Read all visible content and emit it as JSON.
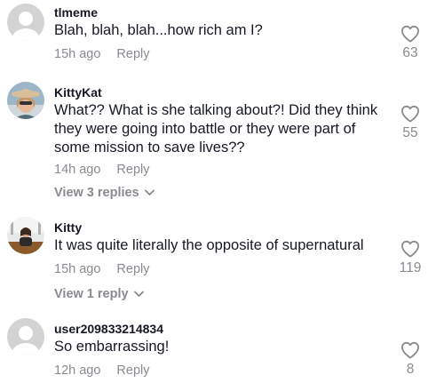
{
  "comments": [
    {
      "username": "tlmeme",
      "text": "Blah, blah, blah...how rich am I?",
      "time": "15h ago",
      "reply_label": "Reply",
      "likes": "63",
      "avatar": "default-avatar-icon"
    },
    {
      "username": "KittyKat",
      "text": "What?? What is she talking about?! Did they think they were going into battle or they were part of some mission to save lives??",
      "time": "14h ago",
      "reply_label": "Reply",
      "likes": "55",
      "view_replies": "View 3 replies",
      "avatar": "profile-photo"
    },
    {
      "username": "Kitty",
      "text": "It was quite literally the opposite of supernatural",
      "time": "15h ago",
      "reply_label": "Reply",
      "likes": "119",
      "view_replies": "View 1 reply",
      "avatar": "profile-photo"
    },
    {
      "username": "user209833214834",
      "text": "So embarrassing!",
      "time": "12h ago",
      "reply_label": "Reply",
      "likes": "8",
      "avatar": "default-avatar-icon"
    }
  ],
  "colors": {
    "primary_text": "#161823",
    "secondary_text": "#8a8b91",
    "default_avatar": "#d3d3d3"
  }
}
